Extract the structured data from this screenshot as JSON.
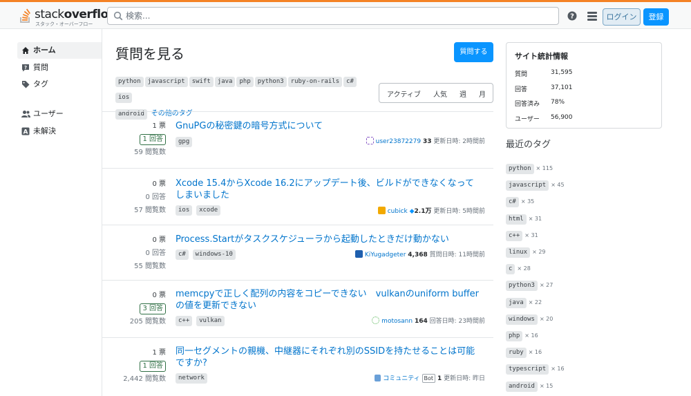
{
  "header": {
    "logo_word_light": "stack",
    "logo_word_bold": "overflow",
    "logo_sub": "スタック・オーバーフロー",
    "search_placeholder": "検索...",
    "login_label": "ログイン",
    "signup_label": "登録",
    "accent_color": "#f48225",
    "icons": [
      "search-icon",
      "help-icon",
      "menu-icon"
    ]
  },
  "sidebar": {
    "items": [
      {
        "label": "ホーム",
        "icon": "home-icon",
        "active": true
      },
      {
        "label": "質問",
        "icon": "questions-icon"
      },
      {
        "label": "タグ",
        "icon": "tag-icon"
      },
      {
        "label": "ユーザー",
        "icon": "users-icon"
      },
      {
        "label": "未解決",
        "icon": "unanswered-icon"
      }
    ]
  },
  "main": {
    "title": "質問を見る",
    "ask_label": "質問する",
    "top_tags": [
      "python",
      "javascript",
      "swift",
      "java",
      "php",
      "python3",
      "ruby-on-rails",
      "c#",
      "ios",
      "android"
    ],
    "more_tags_label": "その他のタグ",
    "filters": [
      "アクティブ",
      "人気",
      "週",
      "月"
    ]
  },
  "questions": [
    {
      "votes": "1 票",
      "answers": "1 回答",
      "answered": true,
      "views": "59 閲覧数",
      "title": "GnuPGの秘密鍵の暗号方式について",
      "tags": [
        "gpg"
      ],
      "user": "user23872279",
      "rep": "33",
      "time": "更新日時: 2時間前"
    },
    {
      "votes": "0 票",
      "answers": "0 回答",
      "answered": false,
      "views": "57 閲覧数",
      "title": "Xcode 15.4からXcode 16.2にアップデート後、ビルドができなくなってしまいました",
      "tags": [
        "ios",
        "xcode"
      ],
      "user": "cubick",
      "rep": "2.1万",
      "time": "更新日時: 5時間前"
    },
    {
      "votes": "0 票",
      "answers": "0 回答",
      "answered": false,
      "views": "55 閲覧数",
      "title": "Process.Startがタスクスケジューラから起動したときだけ動かない",
      "tags": [
        "c#",
        "windows-10"
      ],
      "user": "KiYugadgeter",
      "rep": "4,368",
      "time": "質問日時: 11時間前"
    },
    {
      "votes": "0 票",
      "answers": "3 回答",
      "answered": true,
      "views": "205 閲覧数",
      "title": "memcpyで正しく配列の内容をコピーできない　vulkanのuniform bufferの値を更新できない",
      "tags": [
        "c++",
        "vulkan"
      ],
      "user": "motosann",
      "rep": "164",
      "time": "回答日時: 23時間前"
    },
    {
      "votes": "1 票",
      "answers": "1 回答",
      "answered": true,
      "views": "2,442 閲覧数",
      "title": "同一セグメントの親機、中継器にそれぞれ別のSSIDを持たせることは可能ですか?",
      "tags": [
        "network"
      ],
      "user": "コミュニティ",
      "bot": "Bot",
      "rep": "1",
      "time": "更新日時: 昨日"
    }
  ],
  "site_stats": {
    "title": "サイト統計情報",
    "rows": [
      {
        "label": "質問",
        "value": "31,595"
      },
      {
        "label": "回答",
        "value": "37,101"
      },
      {
        "label": "回答済み",
        "value": "78%"
      },
      {
        "label": "ユーザー",
        "value": "56,900"
      }
    ]
  },
  "recent_tags": {
    "title": "最近のタグ",
    "items": [
      {
        "tag": "python",
        "count": "× 115"
      },
      {
        "tag": "javascript",
        "count": "× 45"
      },
      {
        "tag": "c#",
        "count": "× 35"
      },
      {
        "tag": "html",
        "count": "× 31"
      },
      {
        "tag": "c++",
        "count": "× 31"
      },
      {
        "tag": "linux",
        "count": "× 29"
      },
      {
        "tag": "c",
        "count": "× 28"
      },
      {
        "tag": "python3",
        "count": "× 27"
      },
      {
        "tag": "java",
        "count": "× 22"
      },
      {
        "tag": "windows",
        "count": "× 20"
      },
      {
        "tag": "php",
        "count": "× 16"
      },
      {
        "tag": "ruby",
        "count": "× 16"
      },
      {
        "tag": "typescript",
        "count": "× 16"
      },
      {
        "tag": "android",
        "count": "× 15"
      }
    ]
  }
}
